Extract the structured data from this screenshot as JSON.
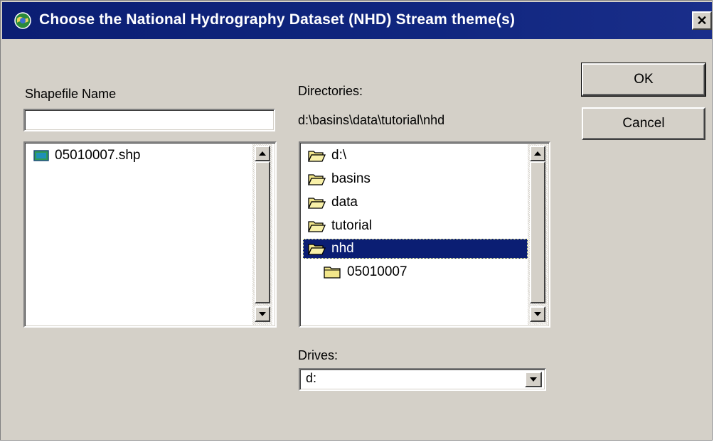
{
  "window": {
    "title": "Choose the National Hydrography Dataset (NHD) Stream theme(s)",
    "close_glyph": "✕"
  },
  "shapefile": {
    "label": "Shapefile Name",
    "input_value": "",
    "files": [
      {
        "name": "05010007.shp",
        "icon": "shapefile-icon"
      }
    ]
  },
  "directories": {
    "label": "Directories:",
    "current_path": "d:\\basins\\data\\tutorial\\nhd",
    "items": [
      {
        "name": "d:\\",
        "icon": "open-folder-icon",
        "selected": false
      },
      {
        "name": "basins",
        "icon": "open-folder-icon",
        "selected": false
      },
      {
        "name": "data",
        "icon": "open-folder-icon",
        "selected": false
      },
      {
        "name": "tutorial",
        "icon": "open-folder-icon",
        "selected": false
      },
      {
        "name": "nhd",
        "icon": "open-folder-icon",
        "selected": true
      },
      {
        "name": "05010007",
        "icon": "closed-folder-icon",
        "selected": false
      }
    ]
  },
  "drives": {
    "label": "Drives:",
    "selected": "d:"
  },
  "buttons": {
    "ok": "OK",
    "cancel": "Cancel"
  },
  "colors": {
    "titlebar": "#0b1e73",
    "face": "#d4d0c8",
    "selection": "#0b1e73",
    "folder": "#f2e68a"
  }
}
